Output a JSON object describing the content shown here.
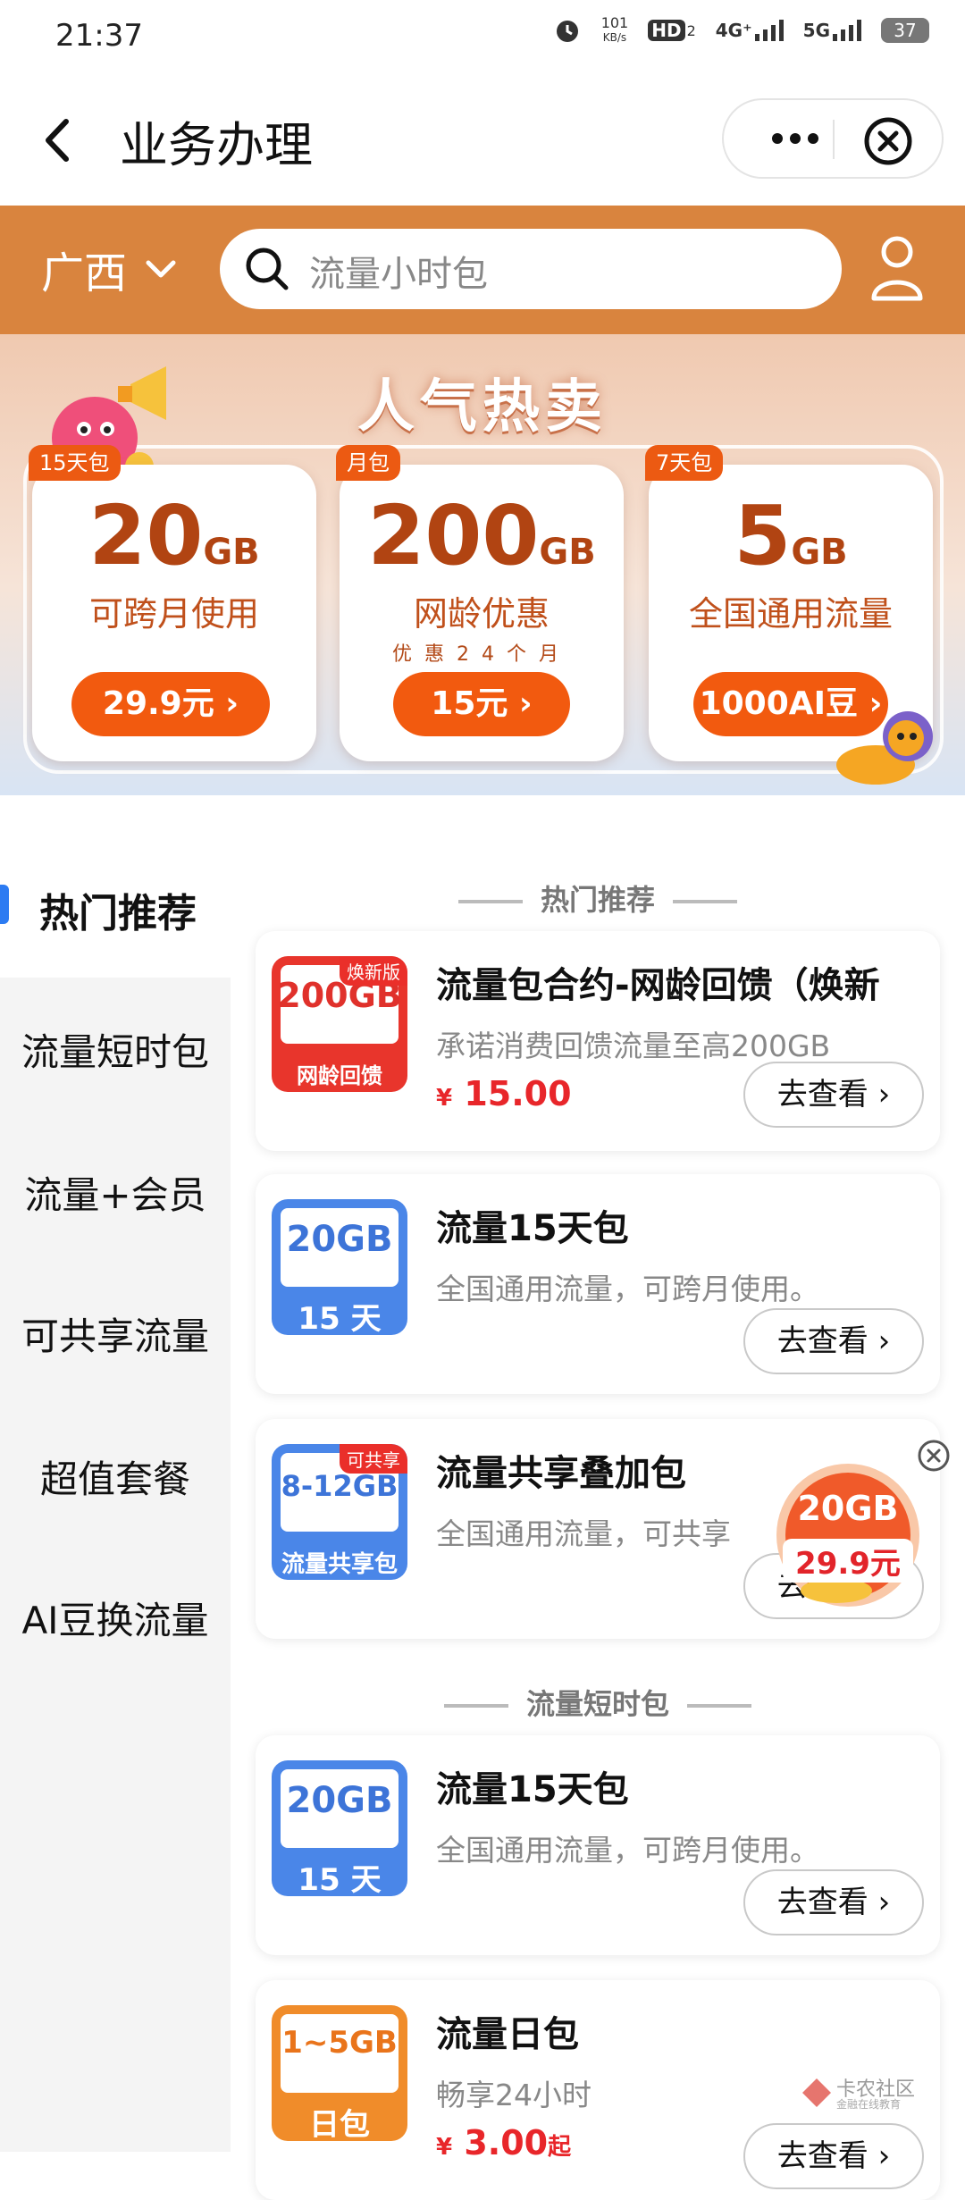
{
  "status_bar": {
    "time": "21:37",
    "net_speed_value": "101",
    "net_speed_unit": "KB/s",
    "hd": "HD",
    "sim2": "2",
    "sig1": "4G⁺",
    "sig2": "5G",
    "battery": "37"
  },
  "header": {
    "back_icon": "chevron-left-icon",
    "title": "业务办理",
    "more_icon": "more-dots-icon",
    "close_icon": "close-circle-icon"
  },
  "search_bar": {
    "region": "广西",
    "placeholder": "流量小时包",
    "search_icon": "search-icon",
    "user_icon": "user-icon",
    "band_color": "#d9843e"
  },
  "banner": {
    "title": "人气热卖",
    "cards": [
      {
        "tag": "15天包",
        "amount": "20",
        "unit": "GB",
        "desc": "可跨月使用",
        "note": "",
        "button": "29.9元 ›"
      },
      {
        "tag": "月包",
        "amount": "200",
        "unit": "GB",
        "desc": "网龄优惠",
        "note": "优惠24个月",
        "button": "15元 ›"
      },
      {
        "tag": "7天包",
        "amount": "5",
        "unit": "GB",
        "desc": "全国通用流量",
        "note": "",
        "button": "1000AI豆 ›"
      }
    ],
    "accent_color": "#f25a0f"
  },
  "sidebar": {
    "items": [
      "热门推荐",
      "流量短时包",
      "流量+会员",
      "可共享流量",
      "超值套餐",
      "AI豆换流量"
    ],
    "active_index": 0,
    "indicator_color": "#2c7bf2"
  },
  "sections": [
    {
      "title": "热门推荐",
      "items": [
        {
          "thumb_gb": "200GB",
          "thumb_sub": "网龄回馈",
          "thumb_corner": "焕新版",
          "title": "流量包合约-网龄回馈（焕新",
          "desc": "承诺消费回馈流量至高200GB",
          "price_symbol": "¥",
          "price": "15.00",
          "price_suffix": "",
          "button": "去查看 ›"
        },
        {
          "thumb_gb": "20GB",
          "thumb_sub": "15 天",
          "thumb_corner": "",
          "title": "流量15天包",
          "desc": "全国通用流量，可跨月使用。",
          "price_symbol": "",
          "price": "",
          "price_suffix": "",
          "button": "去查看 ›"
        },
        {
          "thumb_gb": "8-12GB",
          "thumb_sub": "流量共享包",
          "thumb_corner": "可共享",
          "title": "流量共享叠加包",
          "desc": "全国通用流量，可共享",
          "price_symbol": "",
          "price": "",
          "price_suffix": "",
          "button": "去查看 ›"
        }
      ]
    },
    {
      "title": "流量短时包",
      "items": [
        {
          "thumb_gb": "20GB",
          "thumb_sub": "15 天",
          "thumb_corner": "",
          "title": "流量15天包",
          "desc": "全国通用流量，可跨月使用。",
          "price_symbol": "",
          "price": "",
          "price_suffix": "",
          "button": "去查看 ›"
        },
        {
          "thumb_gb": "1~5GB",
          "thumb_sub": "日包",
          "thumb_corner": "",
          "title": "流量日包",
          "desc": "畅享24小时",
          "price_symbol": "¥",
          "price": "3.00",
          "price_suffix": "起",
          "button": "去查看 ›"
        }
      ]
    }
  ],
  "floating_promo": {
    "amount": "20GB",
    "price": "29.9元"
  },
  "watermark": {
    "text": "卡农社区",
    "sub": "金融在线教育"
  }
}
